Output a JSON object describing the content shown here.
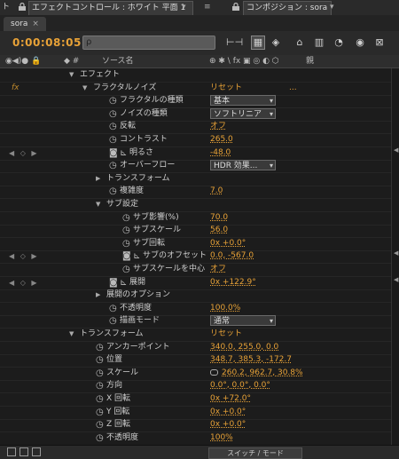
{
  "topbar": {
    "left_cut": "ト",
    "effect_panel": "エフェクトコントロール : ホワイト 平面 1",
    "comp_panel": "コンポジション : sora",
    "menu_icon": "≡"
  },
  "tab": {
    "label": "sora",
    "close": "×"
  },
  "timecode": "0:00:08:05",
  "search": {
    "placeholder": "ρ"
  },
  "toolbar_icons": [
    "ripple-icon",
    "comp-flowchart-icon",
    "3d-draft-icon",
    "shy-layers-icon",
    "frame-blend-icon",
    "motion-blur-icon",
    "graph-editor-icon",
    "brainstorm-icon"
  ],
  "columns": {
    "av": "◉◀)● 🔒",
    "label_tag": "◆ #",
    "source_name": "ソース名",
    "switches": "⊕ ✱ \\ fx ▣ ◎ ◐ ⬡",
    "parent": "親"
  },
  "rows": [
    {
      "name": "エフェクト",
      "level": 0,
      "twirl": "▼"
    },
    {
      "name": "フラクタルノイズ",
      "level": 1,
      "twirl": "▼",
      "fx": "fx",
      "reset": "リセット",
      "extra": "..."
    },
    {
      "name": "フラクタルの種類",
      "level": 2,
      "stopwatch": true,
      "dropdown": "基本"
    },
    {
      "name": "ノイズの種類",
      "level": 2,
      "stopwatch": true,
      "dropdown": "ソフトリニア"
    },
    {
      "name": "反転",
      "level": 2,
      "stopwatch": true,
      "value": "オフ"
    },
    {
      "name": "コントラスト",
      "level": 2,
      "stopwatch": true,
      "value": "265.0"
    },
    {
      "name": "明るさ",
      "level": 2,
      "stopwatch": true,
      "keyed": true,
      "graph": true,
      "value": "-48.0",
      "kf": "◀ ◇ ▶"
    },
    {
      "name": "オーバーフロー",
      "level": 2,
      "stopwatch": true,
      "dropdown": "HDR 効果..."
    },
    {
      "name": "トランスフォーム",
      "level": 2,
      "twirl": "▶"
    },
    {
      "name": "複雑度",
      "level": 2,
      "stopwatch": true,
      "value": "7.0"
    },
    {
      "name": "サブ設定",
      "level": 2,
      "twirl": "▼"
    },
    {
      "name": "サブ影響(%)",
      "level": 3,
      "stopwatch": true,
      "value": "70.0"
    },
    {
      "name": "サブスケール",
      "level": 3,
      "stopwatch": true,
      "value": "56.0"
    },
    {
      "name": "サブ回転",
      "level": 3,
      "stopwatch": true,
      "value": "0x +0.0°"
    },
    {
      "name": "サブのオフセット",
      "level": 3,
      "stopwatch": true,
      "keyed": true,
      "graph": true,
      "value": "0.0, -567.0",
      "kf": "◀ ◇ ▶"
    },
    {
      "name": "サブスケールを中心",
      "level": 3,
      "stopwatch": true,
      "value": "オフ"
    },
    {
      "name": "展開",
      "level": 2,
      "stopwatch": true,
      "keyed": true,
      "graph": true,
      "value": "0x +122.9°",
      "kf": "◀ ◇ ▶"
    },
    {
      "name": "展開のオプション",
      "level": 2,
      "twirl": "▶"
    },
    {
      "name": "不透明度",
      "level": 2,
      "stopwatch": true,
      "value": "100.0%"
    },
    {
      "name": "描画モード",
      "level": 2,
      "stopwatch": true,
      "dropdown": "通常"
    },
    {
      "name": "トランスフォーム",
      "level": 0,
      "twirl": "▼",
      "reset": "リセット"
    },
    {
      "name": "アンカーポイント",
      "level": 1,
      "stopwatch": true,
      "value": "340.0, 255.0, 0.0"
    },
    {
      "name": "位置",
      "level": 1,
      "stopwatch": true,
      "value": "348.7, 385.3, -172.7"
    },
    {
      "name": "スケール",
      "level": 1,
      "stopwatch": true,
      "link": true,
      "value": "260.2, 962.7, 30.8%"
    },
    {
      "name": "方向",
      "level": 1,
      "stopwatch": true,
      "value": "0.0°, 0.0°, 0.0°"
    },
    {
      "name": "X 回転",
      "level": 1,
      "stopwatch": true,
      "value": "0x +72.0°"
    },
    {
      "name": "Y 回転",
      "level": 1,
      "stopwatch": true,
      "value": "0x +0.0°"
    },
    {
      "name": "Z 回転",
      "level": 1,
      "stopwatch": true,
      "value": "0x +0.0°"
    },
    {
      "name": "不透明度",
      "level": 1,
      "stopwatch": true,
      "value": "100%"
    }
  ],
  "bottombar": {
    "toggle_label": "スイッチ / モード"
  }
}
